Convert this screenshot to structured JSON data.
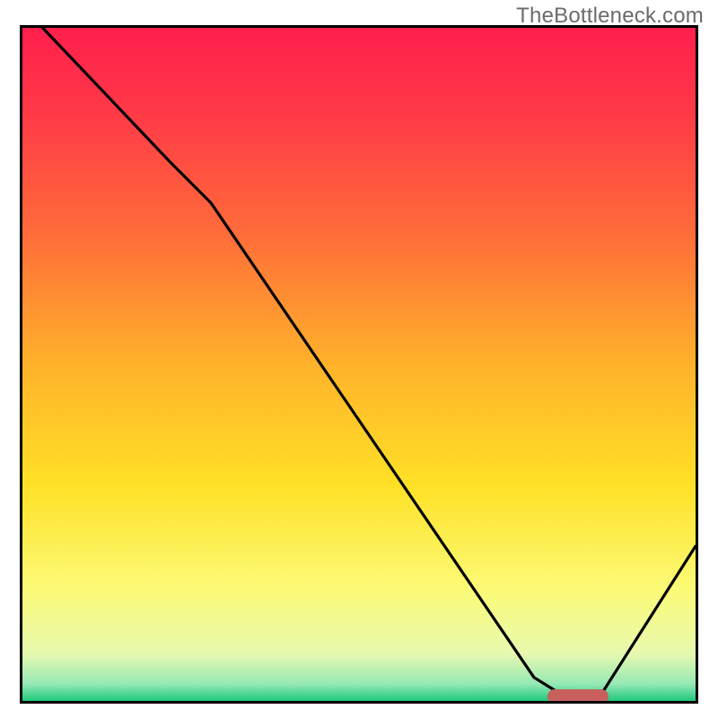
{
  "watermark": "TheBottleneck.com",
  "chart_data": {
    "type": "line",
    "title": "",
    "xlabel": "",
    "ylabel": "",
    "xlim": [
      0,
      100
    ],
    "ylim": [
      0,
      100
    ],
    "background_gradient": {
      "stops": [
        {
          "pos": 0.0,
          "color": "#ff1f4c"
        },
        {
          "pos": 0.12,
          "color": "#ff3847"
        },
        {
          "pos": 0.3,
          "color": "#ff6a3a"
        },
        {
          "pos": 0.5,
          "color": "#ffb22a"
        },
        {
          "pos": 0.68,
          "color": "#ffe126"
        },
        {
          "pos": 0.84,
          "color": "#fbfb7a"
        },
        {
          "pos": 0.93,
          "color": "#e7f9af"
        },
        {
          "pos": 0.975,
          "color": "#95e8b5"
        },
        {
          "pos": 1.0,
          "color": "#1ec87a"
        }
      ]
    },
    "series": [
      {
        "name": "bottleneck-curve",
        "x": [
          3.0,
          22.0,
          28.0,
          76.0,
          80.0,
          86.0,
          100.0
        ],
        "y": [
          100.0,
          80.0,
          74.0,
          3.5,
          1.0,
          1.0,
          23.0
        ]
      }
    ],
    "marker": {
      "name": "bottleneck-optimal-range",
      "x_start": 78.0,
      "x_end": 87.0,
      "y": 0.7,
      "color": "#c8605d"
    }
  }
}
